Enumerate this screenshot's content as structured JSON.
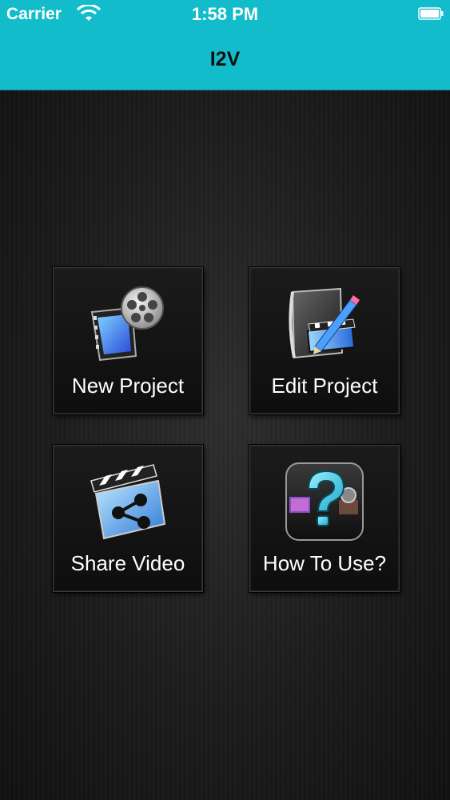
{
  "statusbar": {
    "carrier": "Carrier",
    "time": "1:58 PM",
    "wifi_icon": "wifi-icon",
    "battery_icon": "battery-icon"
  },
  "navbar": {
    "title": "I2V"
  },
  "tiles": [
    {
      "label": "New Project",
      "icon": "film-reel-icon"
    },
    {
      "label": "Edit Project",
      "icon": "edit-pencil-clapper-icon"
    },
    {
      "label": "Share Video",
      "icon": "share-clapper-icon"
    },
    {
      "label": "How To Use?",
      "icon": "question-help-icon"
    }
  ],
  "colors": {
    "accent": "#12bccb",
    "background": "#1a1a1a",
    "text": "#ffffff"
  }
}
